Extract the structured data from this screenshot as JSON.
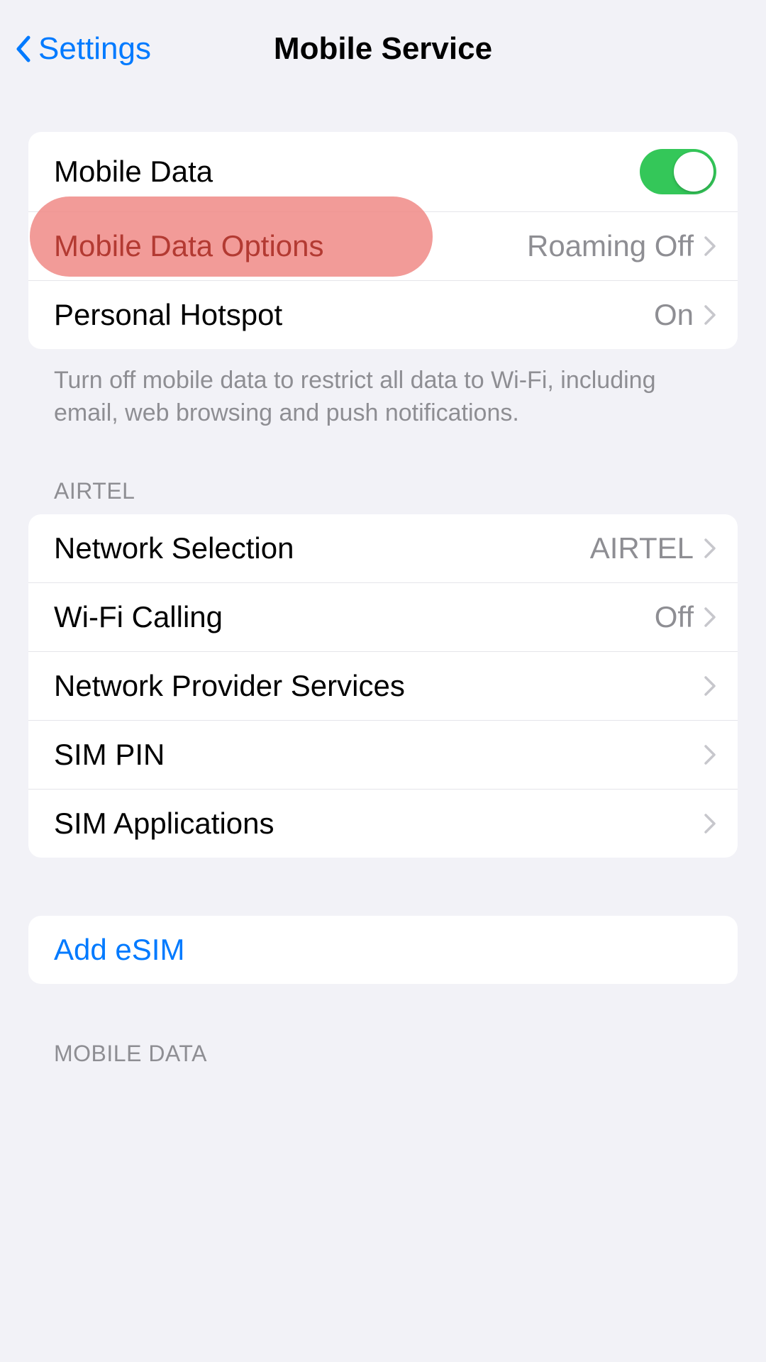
{
  "header": {
    "back_label": "Settings",
    "title": "Mobile Service"
  },
  "group1": {
    "mobile_data_label": "Mobile Data",
    "mobile_data_on": true,
    "mobile_data_options_label": "Mobile Data Options",
    "mobile_data_options_value": "Roaming Off",
    "personal_hotspot_label": "Personal Hotspot",
    "personal_hotspot_value": "On",
    "footer": "Turn off mobile data to restrict all data to Wi-Fi, including email, web browsing and push notifications."
  },
  "section_airtel": "AIRTEL",
  "group2": {
    "network_selection_label": "Network Selection",
    "network_selection_value": "AIRTEL",
    "wifi_calling_label": "Wi-Fi Calling",
    "wifi_calling_value": "Off",
    "network_provider_services_label": "Network Provider Services",
    "sim_pin_label": "SIM PIN",
    "sim_applications_label": "SIM Applications"
  },
  "group3": {
    "add_esim_label": "Add eSIM"
  },
  "section_mobile_data": "MOBILE DATA"
}
